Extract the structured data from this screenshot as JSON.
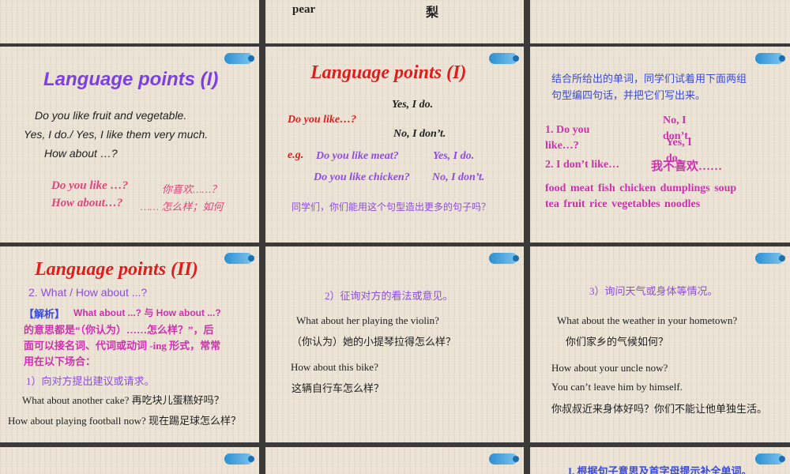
{
  "top": {
    "word": "pear",
    "meaning": "梨"
  },
  "s1": {
    "title": "Language points (I)",
    "line1": "Do you like fruit and vegetable.",
    "line2": "Yes, I do./ Yes, I like them very much.",
    "line3": "How about …?",
    "note1_en": "Do you like …?",
    "note1_cn": "你喜欢……？",
    "note2_en": "How about…?",
    "note2_cn": "…… 怎么样；如何"
  },
  "s2": {
    "title": "Language points (I)",
    "q": "Do you like…?",
    "yes": "Yes, I do.",
    "no": "No, I don’t.",
    "eg": "e.g.",
    "ex1_q": "Do you like meat?",
    "ex1_a": "Yes, I do.",
    "ex2_q": "Do you like chicken?",
    "ex2_a": "No, I don’t.",
    "prompt": "同学们，你们能用这个句型造出更多的句子吗？"
  },
  "s3": {
    "instr1": "结合所给出的单词，同学们试着用下面两组",
    "instr2": "句型编四句话，并把它们写出来。",
    "item1": "1. Do you like…?",
    "no_i": "No, I don’t.",
    "yes_i": "Yes, I do.",
    "item2": "2. I don’t like…",
    "item2_cn": "我不喜欢……",
    "words1": "food  meat  fish  chicken  dumplings  soup",
    "words2": "tea   fruit  rice  vegetables  noodles"
  },
  "s4": {
    "title": "Language points (II)",
    "sub": "2. What / How about ...?",
    "analysis_tag": "【解析】",
    "analysis1": "What about ...? 与 How about ...?",
    "analysis2": "的意思都是“（你认为）……怎么样？”，后",
    "analysis3": "面可以接名词、代词或动词 -ing 形式，常常",
    "analysis4": "用在以下场合：",
    "point1": "1）向对方提出建议或请求。",
    "ex1": "What about another cake?  再吃块儿蛋糕好吗？",
    "ex2": "How about playing football now?  现在踢足球怎么样？"
  },
  "s5": {
    "point2": "2）征询对方的看法或意见。",
    "ex1_en": "What about her playing the violin?",
    "ex1_cn": "（你认为）她的小提琴拉得怎么样？",
    "ex2_en": "How about this bike?",
    "ex2_cn": "这辆自行车怎么样？"
  },
  "s6": {
    "point3": "3）询问天气或身体等情况。",
    "ex1_en": "What about the weather in your hometown?",
    "ex1_cn": "你们家乡的气候如何？",
    "ex2_en": "How about your uncle now?",
    "ex2_en2": "You can’t leave him by himself.",
    "ex2_cn": "你叔叔近来身体好吗？你们不能让他单独生活。"
  },
  "s9": {
    "heading": "I. 根据句子意思及首字母提示补全单词。"
  }
}
